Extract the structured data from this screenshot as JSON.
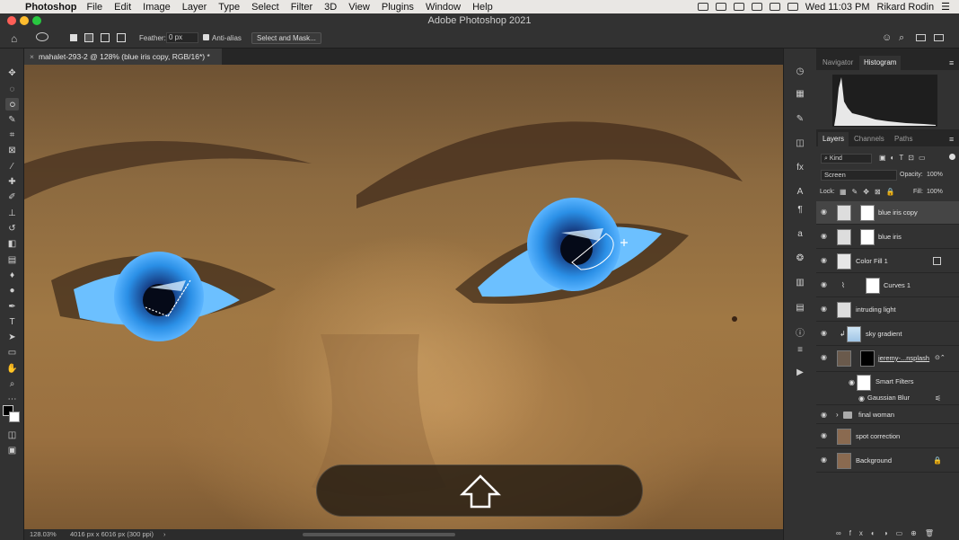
{
  "menubar": {
    "app_name": "Photoshop",
    "items": [
      "File",
      "Edit",
      "Image",
      "Layer",
      "Type",
      "Select",
      "Filter",
      "3D",
      "View",
      "Plugins",
      "Window",
      "Help"
    ],
    "clock": "Wed 11:03 PM",
    "user": "Rikard Rodin"
  },
  "window": {
    "title": "Adobe Photoshop 2021"
  },
  "options": {
    "feather_label": "Feather:",
    "feather_value": "0 px",
    "antialias_label": "Anti-alias",
    "select_mask_label": "Select and Mask..."
  },
  "document": {
    "tab_label": "mahalet-293-2 @ 128% (blue iris copy, RGB/16*) *",
    "zoom": "128.03%",
    "doc_info": "4016 px x 6016 px (300 ppi)"
  },
  "navigator_tabs": [
    "Navigator",
    "Histogram"
  ],
  "layers_tabs": [
    "Layers",
    "Channels",
    "Paths"
  ],
  "layers_panel": {
    "filter_label": "Kind",
    "blend_mode": "Screen",
    "opacity_label": "Opacity:",
    "opacity_value": "100%",
    "lock_label": "Lock:",
    "fill_label": "Fill:",
    "fill_value": "100%"
  },
  "layers": [
    {
      "name": "blue iris copy"
    },
    {
      "name": "blue iris"
    },
    {
      "name": "Color Fill 1"
    },
    {
      "name": "Curves 1"
    },
    {
      "name": "intruding light"
    },
    {
      "name": "sky gradient"
    },
    {
      "name": "jeremy-...nsplash"
    },
    {
      "name": "Smart Filters"
    },
    {
      "name": "Gaussian Blur"
    },
    {
      "name": "final woman"
    },
    {
      "name": "spot correction"
    },
    {
      "name": "Background"
    }
  ],
  "colors": {
    "iris": "#2a8fe6",
    "skin": "#a27845",
    "panel": "#323232"
  }
}
